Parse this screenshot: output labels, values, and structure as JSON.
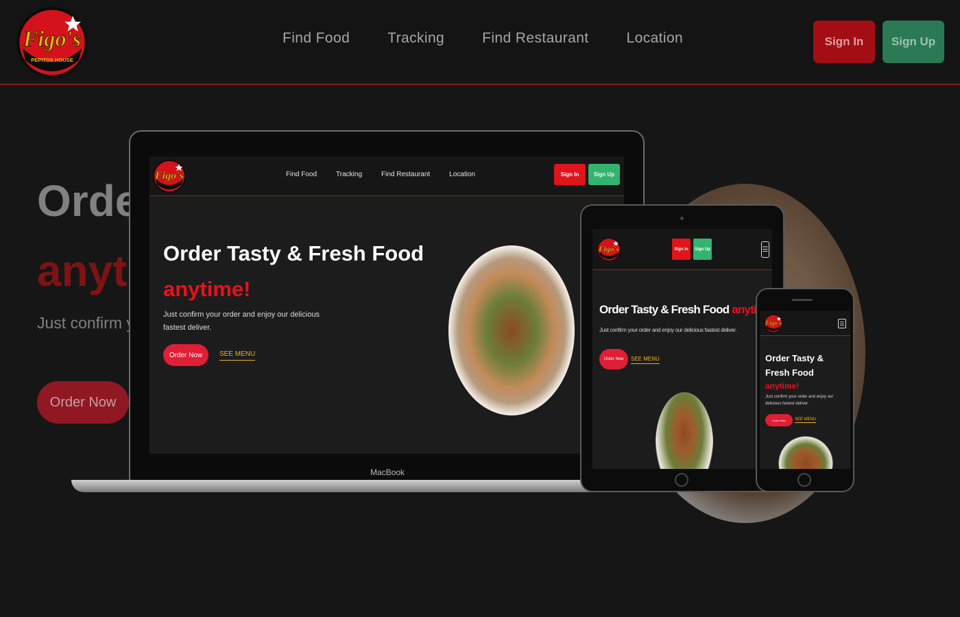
{
  "brand": {
    "name": "Figo's",
    "tagline": "PEPITOS HOUSE",
    "accent": "#e8111b",
    "signin_color": "#a30e14",
    "signup_color": "#2b7a55",
    "link_color": "#f0b41c"
  },
  "header": {
    "nav": [
      "Find Food",
      "Tracking",
      "Find Restaurant",
      "Location"
    ],
    "signin": "Sign In",
    "signup": "Sign Up"
  },
  "hero": {
    "title_partial": "Order",
    "anytime_partial": "anyti",
    "desc_partial": "Just confirm yo fastest deliver.",
    "order_button": "Order Now"
  },
  "laptop": {
    "label": "MacBook",
    "nav": [
      "Find Food",
      "Tracking",
      "Find Restaurant",
      "Location"
    ],
    "signin": "Sign In",
    "signup": "Sign Up",
    "title": "Order Tasty & Fresh Food",
    "anytime": "anytime!",
    "desc": "Just confirm your order and enjoy our delicious fastest deliver.",
    "order_button": "Order Now",
    "see_menu": "SEE MENU"
  },
  "tablet": {
    "signin": "Sign In",
    "signup": "Sign Up",
    "title": "Order Tasty & Fresh Food",
    "anytime": "anytime!",
    "desc": "Just confirm your order and enjoy our delicious fastest deliver.",
    "order_button": "Order Now",
    "see_menu": "SEE MENU"
  },
  "phone": {
    "title": "Order Tasty & Fresh Food",
    "anytime": "anytime!",
    "desc": "Just confirm your order and enjoy our delicious fastest deliver.",
    "order_button": "Order Now",
    "see_menu": "SEE MENU"
  },
  "icons": {
    "menu": "hamburger-menu-icon"
  }
}
